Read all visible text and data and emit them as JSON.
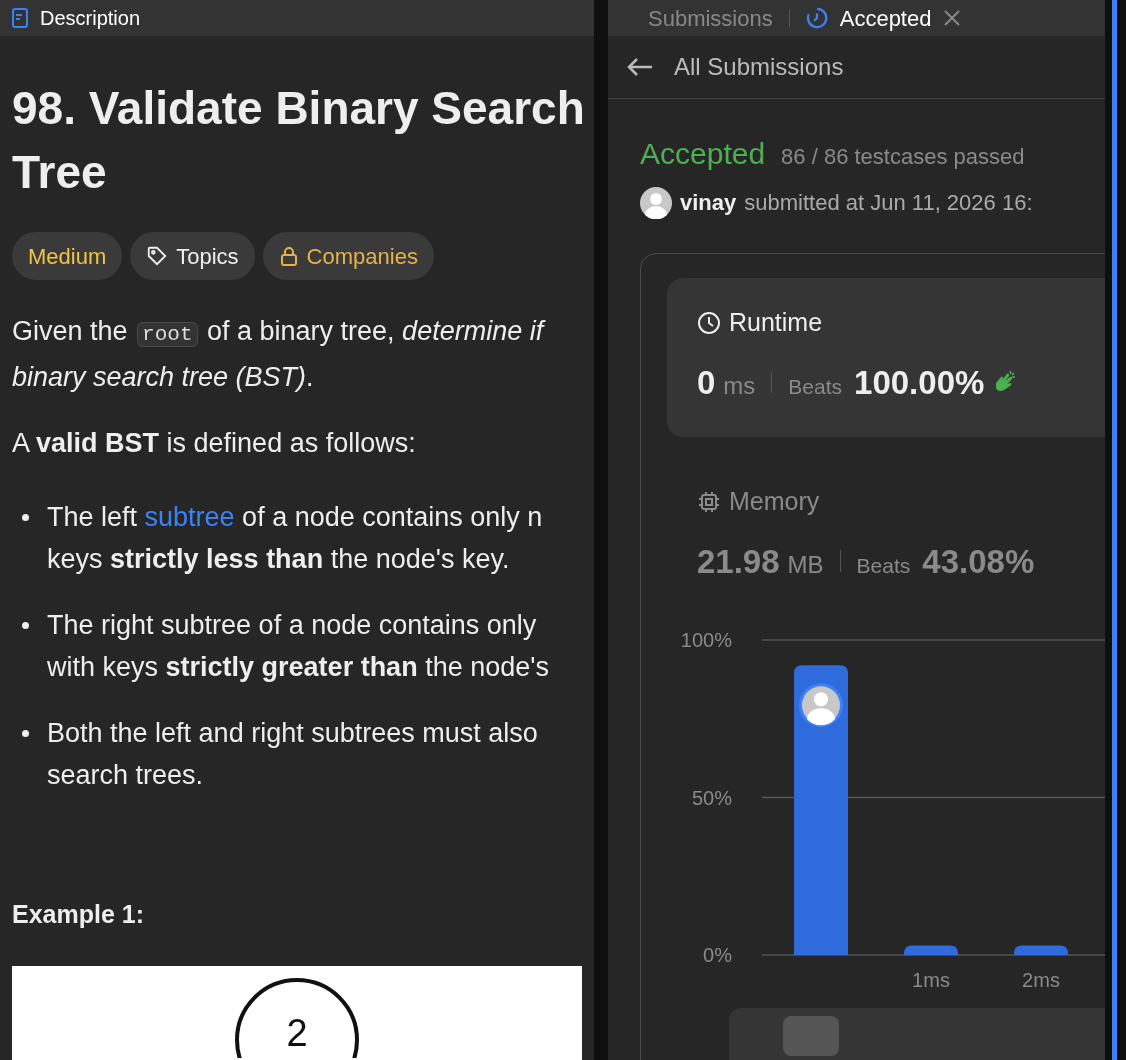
{
  "left_tabs": [
    {
      "label": "Description",
      "selected": true
    }
  ],
  "problem": {
    "title": "98. Validate Binary Search",
    "title_line2": "Tree",
    "tags": [
      {
        "kind": "difficulty",
        "label": "Medium"
      },
      {
        "kind": "topics",
        "label": "Topics"
      },
      {
        "kind": "companies",
        "label": "Companies"
      }
    ],
    "intro_lines": [
      [
        {
          "kind": "text",
          "text": "Given the "
        },
        {
          "kind": "code",
          "text": "root"
        },
        {
          "kind": "text",
          "text": " of a binary tree, *determine if*"
        }
      ],
      [
        {
          "kind": "text",
          "text": "*binary search tree (BST)*."
        }
      ]
    ],
    "definition": "A **valid BST** is defined as follows:",
    "bullets": [
      {
        "lines": [
          [
            {
              "kind": "text",
              "text": "The left "
            },
            {
              "kind": "link",
              "text": "subtree"
            },
            {
              "kind": "text",
              "text": " of a node contains only n"
            }
          ],
          [
            {
              "kind": "text",
              "text": "keys **strictly less than** the node's key."
            }
          ]
        ]
      },
      {
        "lines": [
          [
            {
              "kind": "text",
              "text": "The right subtree of a node contains only"
            }
          ],
          [
            {
              "kind": "text",
              "text": "with keys **strictly greater than** the node's"
            }
          ]
        ]
      },
      {
        "lines": [
          [
            {
              "kind": "text",
              "text": "Both the left and right subtrees must also"
            }
          ],
          [
            {
              "kind": "text",
              "text": "search trees."
            }
          ]
        ]
      }
    ],
    "example_title": "Example 1:",
    "example_node": "2"
  },
  "right_tabs": [
    {
      "label": "Submissions",
      "selected": false,
      "closable": false
    },
    {
      "label": "Accepted",
      "selected": true,
      "closable": true
    }
  ],
  "back_link": "All Submissions",
  "result": {
    "status": "Accepted",
    "testcases": "86 / 86 testcases passed",
    "user": "vinay",
    "submitted": "submitted at Jun 11, 2026 16:"
  },
  "stats": [
    {
      "kind": "runtime",
      "title": "Runtime",
      "selected": true,
      "value": "0",
      "unit": "ms",
      "beats_label": "Beats",
      "beats": "100.00%"
    },
    {
      "kind": "memory",
      "title": "Memory",
      "selected": false,
      "value": "21.98",
      "unit": "MB",
      "beats_label": "Beats",
      "beats": "43.08%"
    }
  ],
  "chart_data": {
    "type": "bar",
    "categories": [
      null,
      "1ms",
      "2ms"
    ],
    "series": [
      {
        "color": "#2f6bdc",
        "values": [
          92,
          3,
          3
        ]
      }
    ],
    "ylim": [
      0,
      100
    ],
    "yticks": [
      {
        "value": 0,
        "label": "0%"
      },
      {
        "value": 50,
        "label": "50%"
      },
      {
        "value": 100,
        "label": "100%"
      }
    ]
  }
}
